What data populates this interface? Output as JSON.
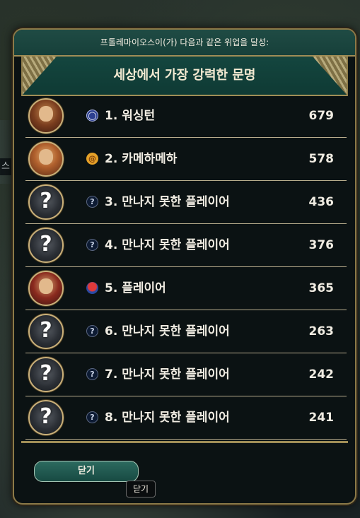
{
  "popup": {
    "achievement_text": "프톨레마이오스이(가) 다음과 같은 위업을 달성:",
    "title": "세상에서 가장 강력한 문명",
    "close_label": "닫기",
    "tooltip": "닫기"
  },
  "rankings": [
    {
      "rank_label": "1. 워싱턴",
      "score": "679",
      "portrait": "leader1",
      "civ_icon": "usa-civ-icon"
    },
    {
      "rank_label": "2. 카메하메하",
      "score": "578",
      "portrait": "leader2",
      "civ_icon": "hawaii-civ-icon"
    },
    {
      "rank_label": "3. 만나지 못한 플레이어",
      "score": "436",
      "portrait": "unknown",
      "civ_icon": "unknown-civ-icon"
    },
    {
      "rank_label": "4. 만나지 못한 플레이어",
      "score": "376",
      "portrait": "unknown",
      "civ_icon": "unknown-civ-icon"
    },
    {
      "rank_label": "5. 플레이어",
      "score": "365",
      "portrait": "leader3",
      "civ_icon": "korea-civ-icon"
    },
    {
      "rank_label": "6. 만나지 못한 플레이어",
      "score": "263",
      "portrait": "unknown",
      "civ_icon": "unknown-civ-icon"
    },
    {
      "rank_label": "7. 만나지 못한 플레이어",
      "score": "242",
      "portrait": "unknown",
      "civ_icon": "unknown-civ-icon"
    },
    {
      "rank_label": "8. 만나지 못한 플레이어",
      "score": "241",
      "portrait": "unknown",
      "civ_icon": "unknown-civ-icon"
    }
  ],
  "unknown_symbol": "?",
  "background_fragment": "스",
  "colors": {
    "header": "#1f4b44",
    "frame_gold": "#a08d56",
    "panel_bg": "#0b1213",
    "text": "#f0ece2"
  }
}
